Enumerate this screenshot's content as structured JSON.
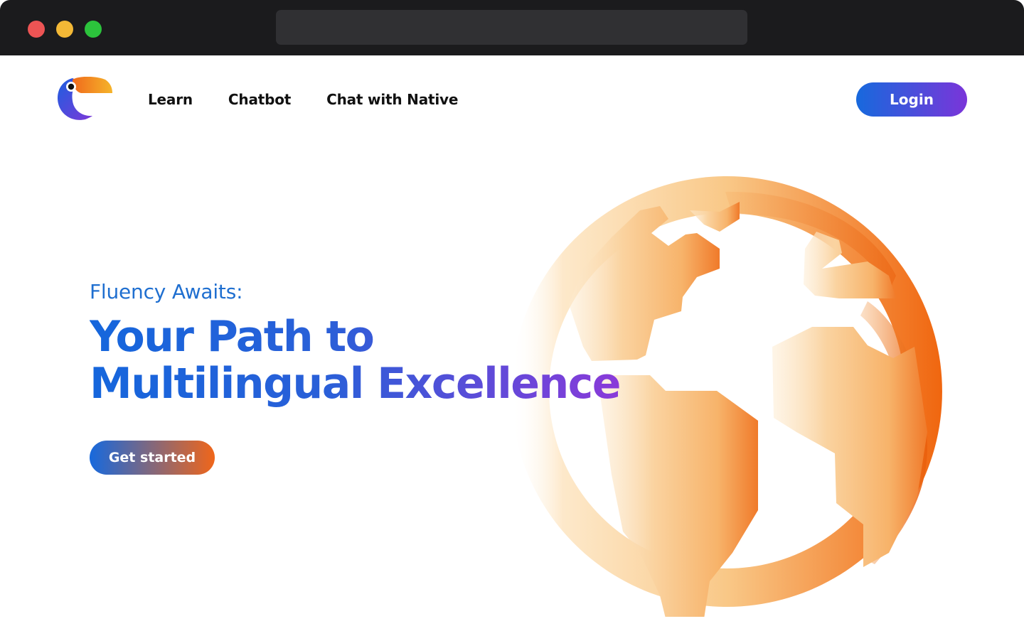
{
  "nav": {
    "items": [
      "Learn",
      "Chatbot",
      "Chat with Native"
    ],
    "login_label": "Login"
  },
  "hero": {
    "eyebrow": "Fluency Awaits:",
    "headline_line1": "Your Path to",
    "headline_line2": "Multilingual Excellence",
    "cta_label": "Get started"
  },
  "icons": {
    "logo": "toucan-logo",
    "illustration": "globe-icon"
  },
  "colors": {
    "brand_blue": "#1769dd",
    "brand_purple": "#7a35d9",
    "accent_orange": "#f0661a",
    "chrome_dark": "#1b1b1d"
  }
}
